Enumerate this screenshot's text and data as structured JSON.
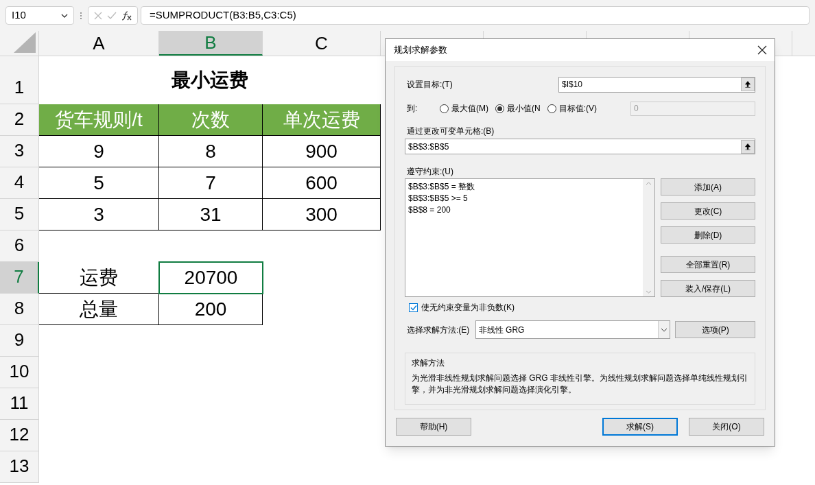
{
  "formula_bar": {
    "name_box": "I10",
    "formula": "=SUMPRODUCT(B3:B5,C3:C5)"
  },
  "columns": [
    {
      "label": "A",
      "selected": false
    },
    {
      "label": "B",
      "selected": true
    },
    {
      "label": "C",
      "selected": false
    }
  ],
  "rows": [
    {
      "label": "1",
      "selected": false,
      "cells": [
        {
          "kind": "title",
          "text": "最小运费"
        }
      ]
    },
    {
      "label": "2",
      "selected": false,
      "cells": [
        {
          "kind": "header",
          "text": "货车规则/t"
        },
        {
          "kind": "header",
          "text": "次数"
        },
        {
          "kind": "header",
          "text": "单次运费"
        }
      ]
    },
    {
      "label": "3",
      "selected": false,
      "cells": [
        {
          "kind": "data",
          "text": "9"
        },
        {
          "kind": "data",
          "text": "8"
        },
        {
          "kind": "data",
          "text": "900"
        }
      ]
    },
    {
      "label": "4",
      "selected": false,
      "cells": [
        {
          "kind": "data",
          "text": "5"
        },
        {
          "kind": "data",
          "text": "7"
        },
        {
          "kind": "data",
          "text": "600"
        }
      ]
    },
    {
      "label": "5",
      "selected": false,
      "cells": [
        {
          "kind": "data",
          "text": "3"
        },
        {
          "kind": "data",
          "text": "31"
        },
        {
          "kind": "data",
          "text": "300"
        }
      ]
    },
    {
      "label": "6",
      "selected": false,
      "cells": []
    },
    {
      "label": "7",
      "selected": true,
      "cells": [
        {
          "kind": "data",
          "text": "运费"
        },
        {
          "kind": "data",
          "text": "20700",
          "selected": true
        }
      ]
    },
    {
      "label": "8",
      "selected": false,
      "cells": [
        {
          "kind": "data",
          "text": "总量"
        },
        {
          "kind": "data",
          "text": "200"
        }
      ]
    },
    {
      "label": "9",
      "selected": false,
      "cells": []
    },
    {
      "label": "10",
      "selected": false,
      "cells": []
    },
    {
      "label": "11",
      "selected": false,
      "cells": []
    },
    {
      "label": "12",
      "selected": false,
      "cells": []
    },
    {
      "label": "13",
      "selected": false,
      "cells": []
    }
  ],
  "dialog": {
    "title": "规划求解参数",
    "target": {
      "label": "设置目标:(T)",
      "value": "$I$10"
    },
    "to": {
      "label": "到:",
      "options": [
        {
          "label": "最大值(M)",
          "selected": false
        },
        {
          "label": "最小值(N",
          "selected": true
        },
        {
          "label": "目标值:(V)",
          "selected": false
        }
      ],
      "value": "0",
      "disabled": true
    },
    "changing": {
      "label": "通过更改可变单元格:(B)",
      "value": "$B$3:$B$5"
    },
    "constraints": {
      "label": "遵守约束:(U)",
      "items": [
        "$B$3:$B$5 = 整数",
        "$B$3:$B$5 >= 5",
        "$B$8 = 200"
      ]
    },
    "side_button_groups": [
      [
        "添加(A)",
        "更改(C)",
        "删除(D)"
      ],
      [
        "全部重置(R)",
        "装入/保存(L)"
      ]
    ],
    "nonnegative": {
      "label": "使无约束变量为非负数(K)",
      "checked": true
    },
    "method": {
      "label": "选择求解方法:(E)",
      "value": "非线性 GRG",
      "options_button": "选项(P)"
    },
    "description": {
      "title": "求解方法",
      "text": "为光滑非线性规划求解问题选择 GRG 非线性引擎。为线性规划求解问题选择单纯线性规划引擎，并为非光滑规划求解问题选择演化引擎。"
    },
    "footer_buttons": [
      {
        "label": "帮助(H)",
        "default": false
      },
      {
        "label": "求解(S)",
        "default": true
      },
      {
        "label": "关闭(O)",
        "default": false
      }
    ]
  }
}
